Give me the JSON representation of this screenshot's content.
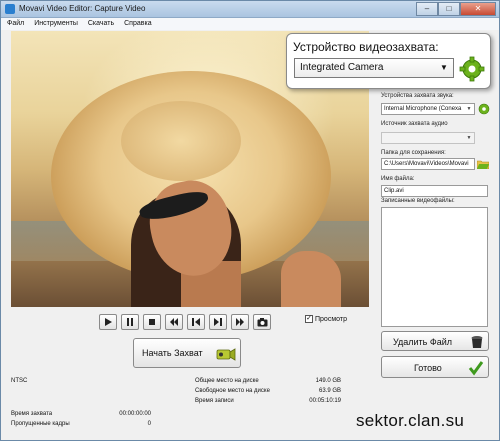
{
  "window": {
    "title": "Movavi Video Editor: Capture Video",
    "minimize": "–",
    "maximize": "□",
    "close": "✕"
  },
  "menu": [
    "Файл",
    "Инструменты",
    "Скачать",
    "Справка"
  ],
  "device_popup": {
    "label": "Устройство видеозахвата:",
    "value": "Integrated Camera"
  },
  "side": {
    "audio_device_label": "Устройства захвата звука:",
    "audio_device_value": "Internal Microphone (Conexa",
    "audio_source_label": "Источник захвата аудио",
    "audio_source_value": "",
    "folder_label": "Папка для сохранения:",
    "folder_value": "C:\\Users\\Movavi\\Videos\\Movavi",
    "filename_label": "Имя файла:",
    "filename_value": "Clip.avi",
    "recorded_label": "Записанные видеофайлы:"
  },
  "buttons": {
    "delete_file": "Удалить Файл",
    "done": "Готово",
    "start_capture": "Начать Захват"
  },
  "preview_label": "Просмотр",
  "info": {
    "standard": "NTSC",
    "total_disk_label": "Общее место на диске",
    "total_disk_value": "149.0 GB",
    "free_disk_label": "Свободное место на диске",
    "free_disk_value": "63.9 GB",
    "record_time_label": "Время записи",
    "record_time_value": "00:05:10:19",
    "capture_time_label": "Время захвата",
    "capture_time_value": "00:00:00:00",
    "dropped_frames_label": "Пропущенные кадры",
    "dropped_frames_value": "0"
  },
  "watermark": "sektor.clan.su",
  "colors": {
    "accent_green": "#6cb21c",
    "title_bar": "#b7cde6"
  }
}
